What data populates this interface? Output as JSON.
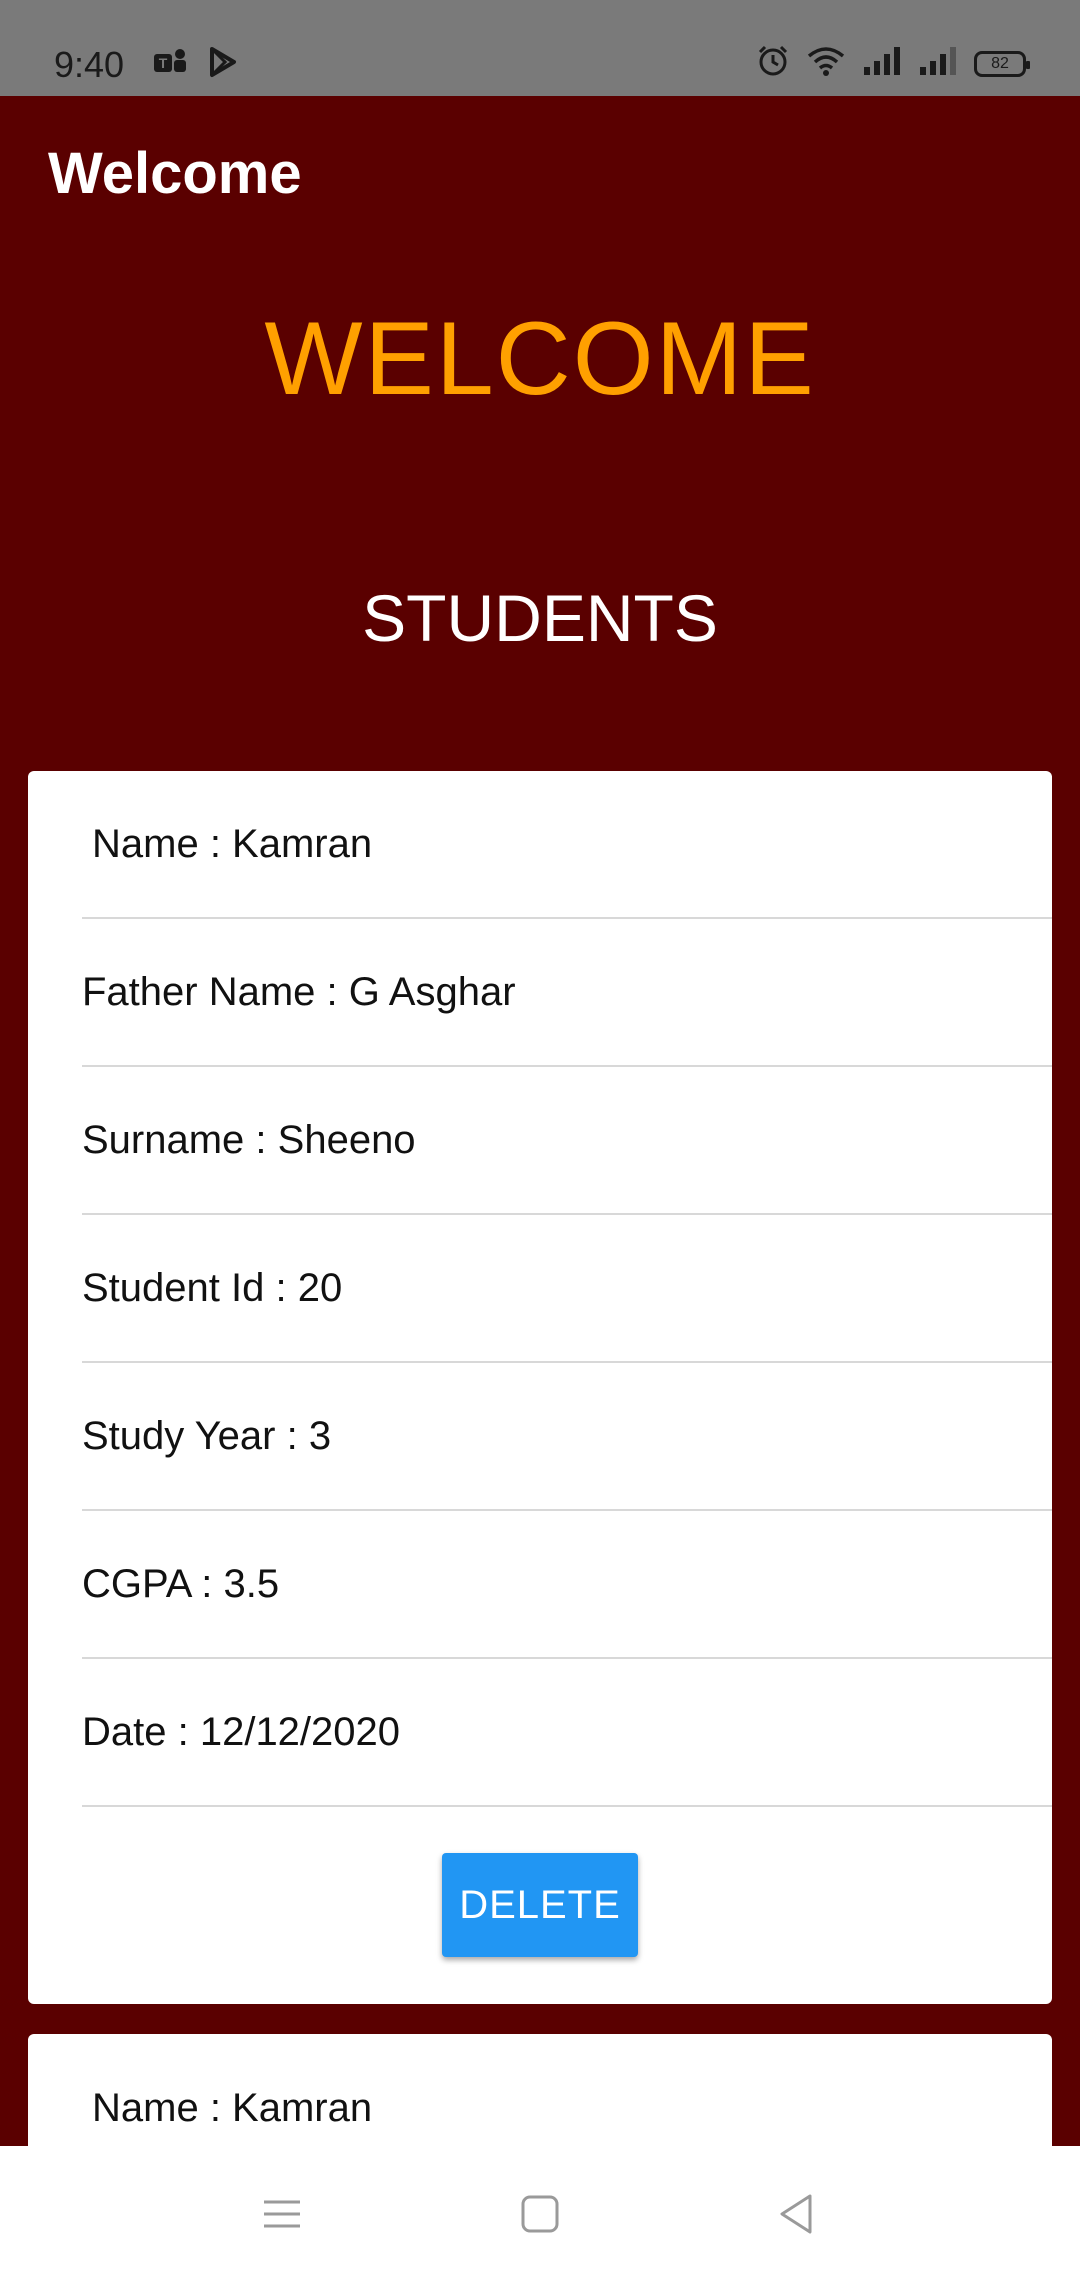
{
  "status": {
    "time": "9:40",
    "battery": "82",
    "left_icons": [
      "teams-icon",
      "play-store-icon"
    ],
    "right_icons": [
      "alarm-icon",
      "wifi-icon",
      "signal-icon",
      "signal-icon"
    ]
  },
  "app_bar": {
    "title": "Welcome"
  },
  "hero": {
    "title": "WELCOME"
  },
  "section": {
    "title": "STUDENTS"
  },
  "students": [
    {
      "name": "Name : Kamran",
      "father_name": "Father Name : G Asghar",
      "surname": "Surname : Sheeno",
      "student_id": "Student Id : 20",
      "study_year": "Study Year : 3",
      "cgpa": "CGPA : 3.5",
      "date": "Date : 12/12/2020",
      "delete_label": "DELETE"
    },
    {
      "name": "Name : Kamran"
    }
  ],
  "nav": {
    "icons": [
      "menu-icon",
      "home-icon",
      "back-icon"
    ]
  },
  "colors": {
    "background": "#5a0000",
    "accent": "#ffa000",
    "button": "#2196f3",
    "status_bar": "#7a7a7a"
  }
}
